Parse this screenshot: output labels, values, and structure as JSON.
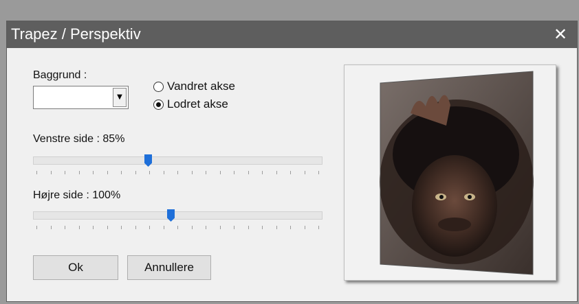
{
  "dialog": {
    "title": "Trapez / Perspektiv",
    "close_icon": "close-icon"
  },
  "background": {
    "label": "Baggrund :",
    "value": "",
    "dropdown_icon": "chevron-down-icon"
  },
  "axis": {
    "options": [
      {
        "label": "Vandret akse",
        "selected": false
      },
      {
        "label": "Lodret akse",
        "selected": true
      }
    ]
  },
  "left_side": {
    "label": "Venstre side : 85%",
    "value_percent": 85
  },
  "right_side": {
    "label": "Højre side : 100%",
    "value_percent": 100
  },
  "buttons": {
    "ok": "Ok",
    "cancel": "Annullere"
  },
  "colors": {
    "titlebar": "#5e5e5e",
    "accent": "#1e6fd9",
    "panel": "#f0f0f0"
  }
}
